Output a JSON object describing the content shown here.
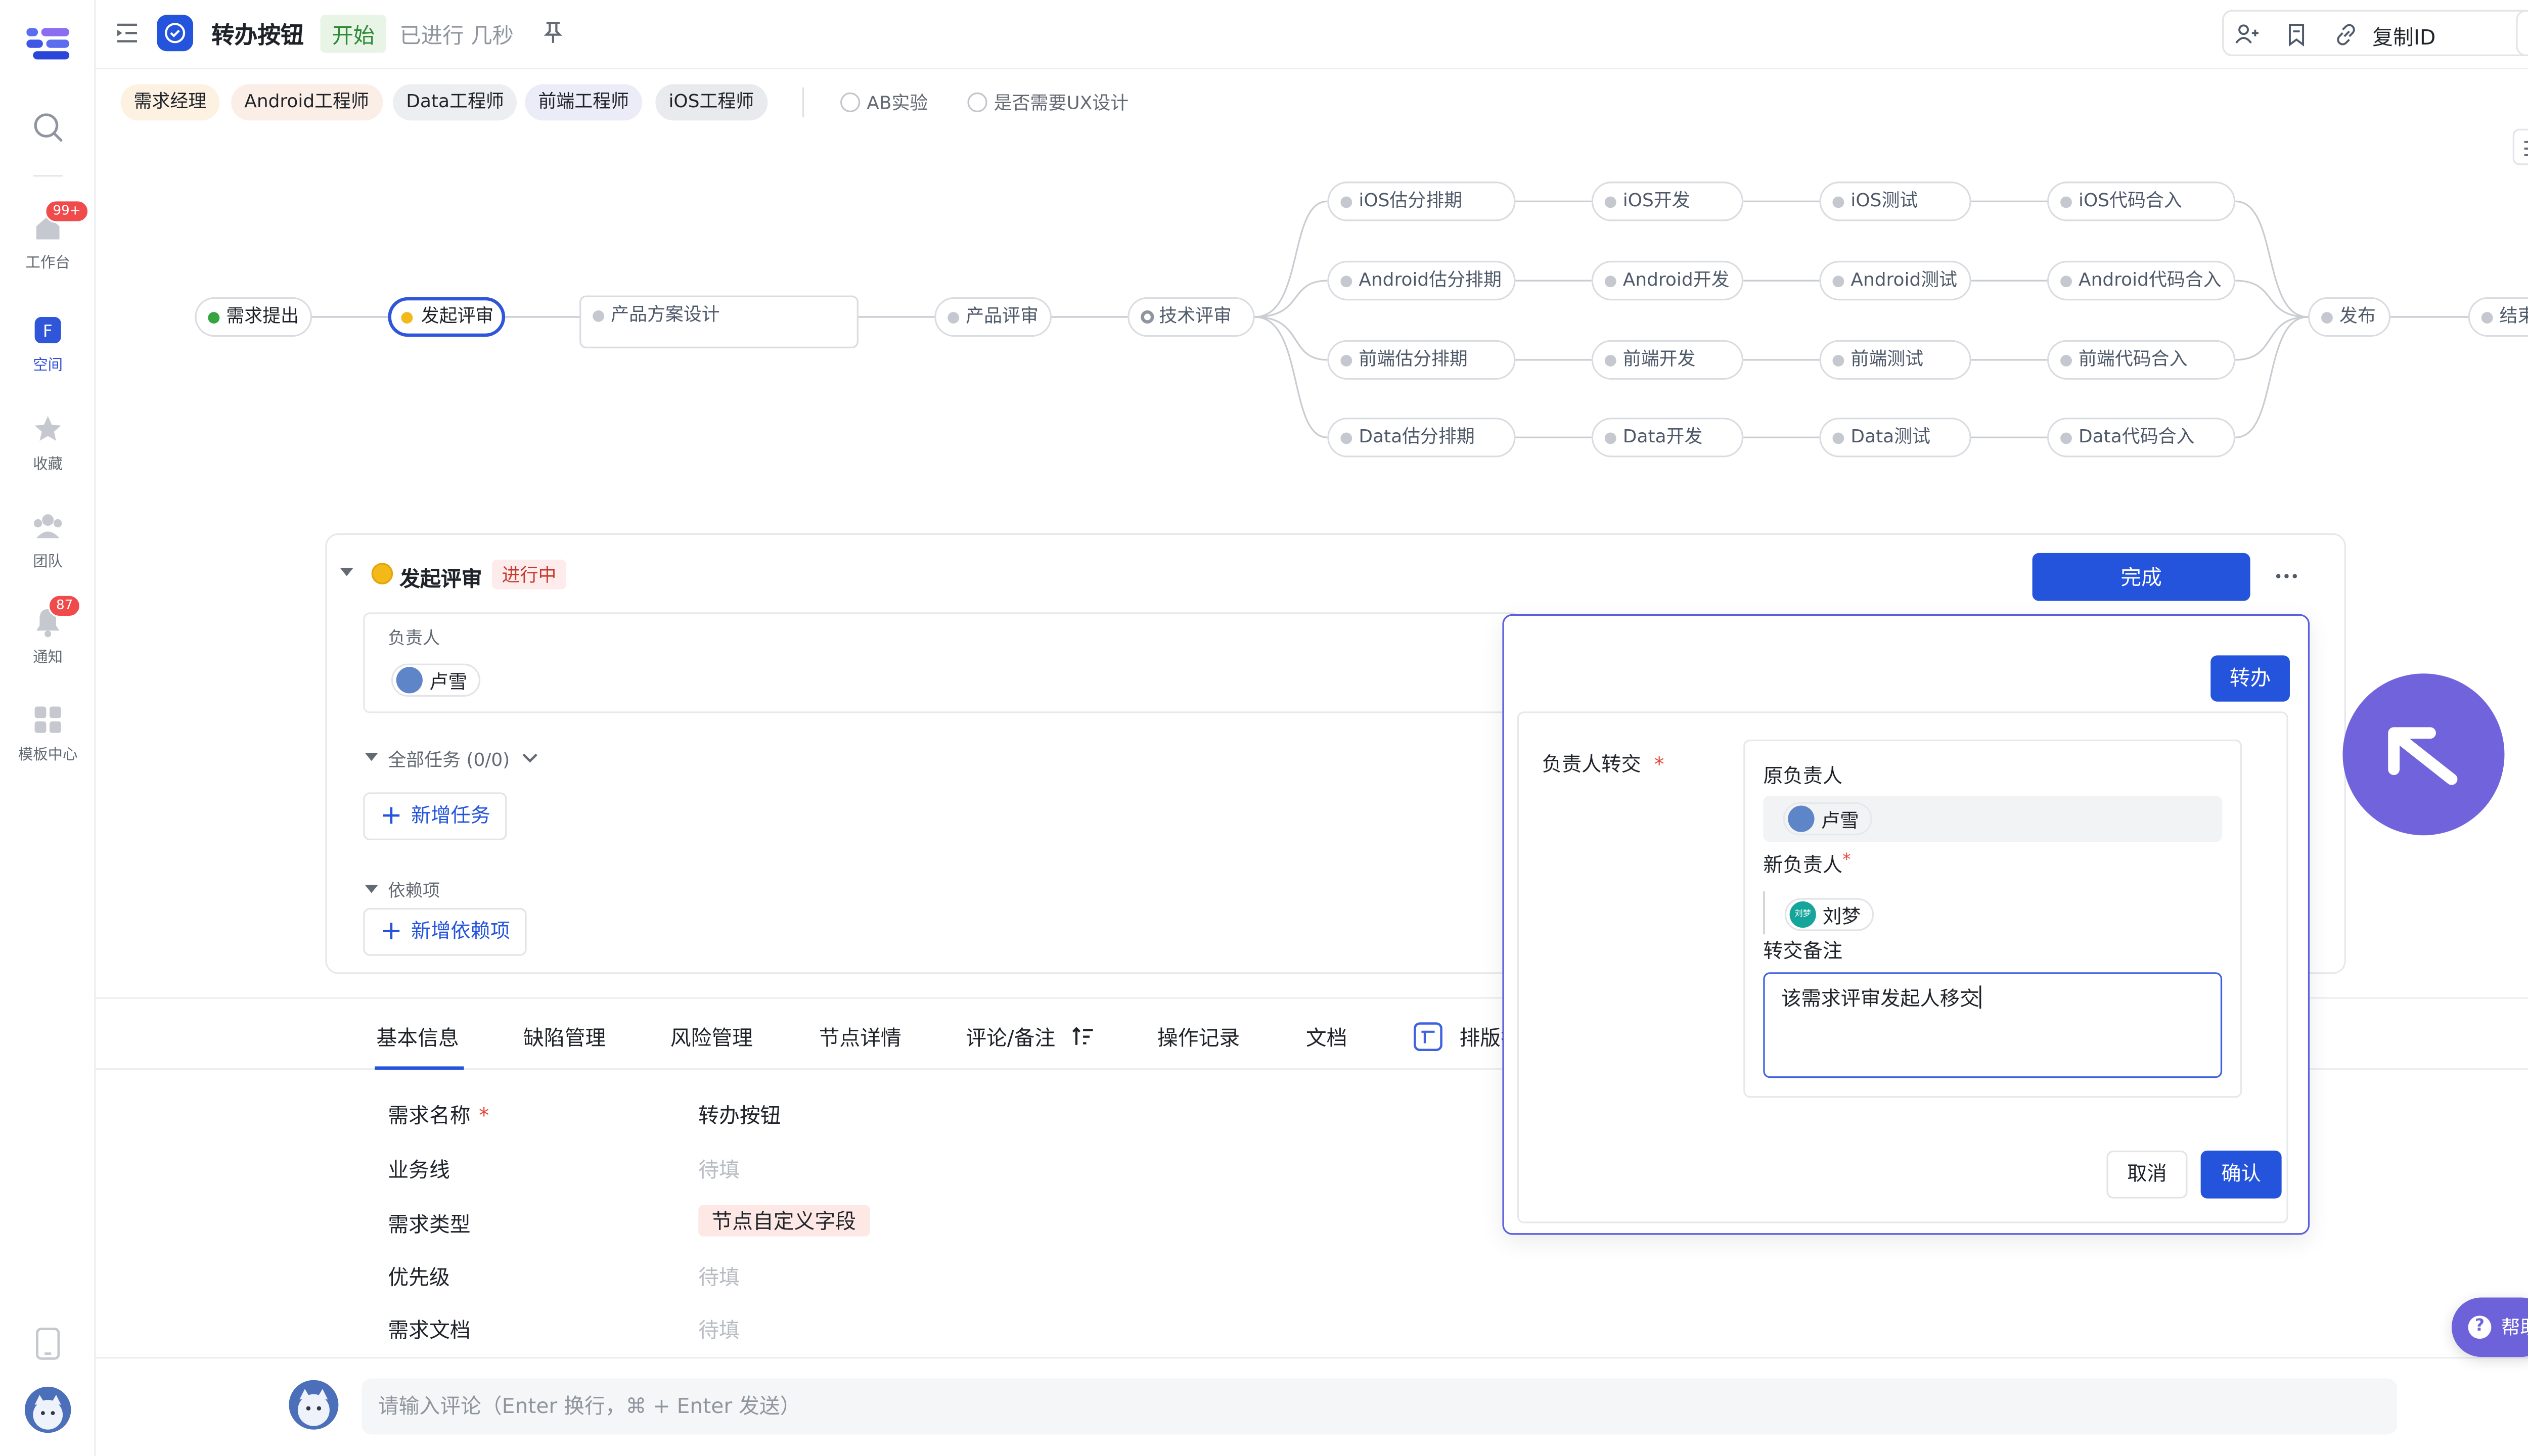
{
  "rail": {
    "items": [
      {
        "label": "工作台",
        "badge": "99+"
      },
      {
        "label": "空间"
      },
      {
        "label": "收藏"
      },
      {
        "label": "团队"
      },
      {
        "label": "通知",
        "badge": "87"
      },
      {
        "label": "模板中心"
      }
    ]
  },
  "header": {
    "title": "转办按钮",
    "status": "开始",
    "time": "已进行 几秒",
    "copy_id": "复制ID"
  },
  "roles": [
    "需求经理",
    "Android工程师",
    "Data工程师",
    "前端工程师",
    "iOS工程师"
  ],
  "options": [
    "AB实验",
    "是否需要UX设计"
  ],
  "flow": {
    "main": [
      "需求提出",
      "发起评审",
      "产品方案设计",
      "产品评审",
      "技术评审"
    ],
    "ios": [
      "iOS估分排期",
      "iOS开发",
      "iOS测试",
      "iOS代码合入"
    ],
    "android": [
      "Android估分排期",
      "Android开发",
      "Android测试",
      "Android代码合入"
    ],
    "frontend": [
      "前端估分排期",
      "前端开发",
      "前端测试",
      "前端代码合入"
    ],
    "data": [
      "Data估分排期",
      "Data开发",
      "Data测试",
      "Data代码合入"
    ],
    "end": [
      "发布",
      "结束"
    ]
  },
  "card": {
    "title": "发起评审",
    "status": "进行中",
    "complete": "完成",
    "owner_label": "负责人",
    "owner": "卢雪",
    "tasks_label": "全部任务 (0/0)",
    "add_task": "新增任务",
    "deps_label": "依赖项",
    "add_dep": "新增依赖项"
  },
  "tabs": [
    "基本信息",
    "缺陷管理",
    "风险管理",
    "节点详情",
    "评论/备注",
    "操作记录",
    "文档",
    "排版打"
  ],
  "info": {
    "rows": [
      {
        "label": "需求名称",
        "value": "转办按钮"
      },
      {
        "label": "业务线",
        "value": "待填"
      },
      {
        "label": "需求类型",
        "value": "节点自定义字段"
      },
      {
        "label": "优先级",
        "value": "待填"
      },
      {
        "label": "需求文档",
        "value": "待填"
      }
    ]
  },
  "comment": {
    "placeholder": "请输入评论（Enter 换行，⌘ + Enter 发送）"
  },
  "popup": {
    "transfer": "转办",
    "field_label": "负责人转交",
    "orig_label": "原负责人",
    "orig_user": "卢雪",
    "new_label": "新负责人",
    "new_user": "刘梦",
    "new_user_avatar_text": "刘梦",
    "note_label": "转交备注",
    "note_value": "该需求评审发起人移交",
    "cancel": "取消",
    "confirm": "确认"
  },
  "help": "帮助",
  "colors": {
    "accent": "#2453dc",
    "popup_border": "#5b5fdf",
    "cursor": "#7063dc"
  }
}
